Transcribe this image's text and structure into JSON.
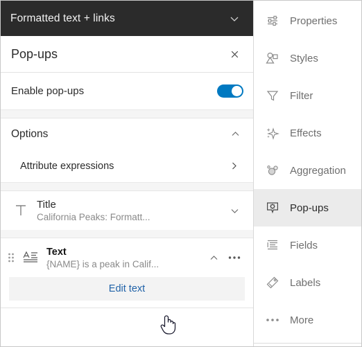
{
  "window": {
    "titlebar": {
      "title": "Formatted text + links",
      "chevron_icon": "chevron-down-icon"
    }
  },
  "panel": {
    "header": {
      "title": "Pop-ups",
      "close_icon": "close-icon"
    },
    "enable": {
      "label": "Enable pop-ups",
      "toggle_state": "on",
      "toggle_color": "#0079c1"
    },
    "options_section": {
      "title": "Options",
      "collapse_icon": "chevron-up-icon",
      "items": [
        {
          "label": "Attribute expressions",
          "chevron_icon": "chevron-right-icon"
        }
      ]
    },
    "elements": [
      {
        "name": "Title",
        "subtitle": "California Peaks: Formatt...",
        "icon": "text-title-icon",
        "action_icon": "chevron-down-icon",
        "has_handle": false,
        "has_more": false
      },
      {
        "name": "Text",
        "subtitle": "{NAME} is a peak in Calif...",
        "icon": "text-block-icon",
        "action_icon": "chevron-up-icon",
        "more_icon": "more-horizontal-icon",
        "handle_icon": "drag-handle-icon",
        "has_handle": true,
        "has_more": true
      }
    ],
    "edit_button": {
      "label": "Edit text",
      "color": "#2062a8"
    }
  },
  "sidebar": {
    "active_item": "Pop-ups",
    "items": [
      {
        "label": "Properties",
        "icon": "sliders-icon"
      },
      {
        "label": "Styles",
        "icon": "styles-shapes-icon"
      },
      {
        "label": "Filter",
        "icon": "funnel-icon"
      },
      {
        "label": "Effects",
        "icon": "sparkle-icon"
      },
      {
        "label": "Aggregation",
        "icon": "aggregation-dots-icon"
      },
      {
        "label": "Pop-ups",
        "icon": "popup-gear-icon"
      },
      {
        "label": "Fields",
        "icon": "fields-list-icon"
      },
      {
        "label": "Labels",
        "icon": "label-tag-icon"
      },
      {
        "label": "More",
        "icon": "more-horizontal-icon"
      }
    ]
  },
  "cursor": {
    "type": "pointing-hand-cursor"
  }
}
